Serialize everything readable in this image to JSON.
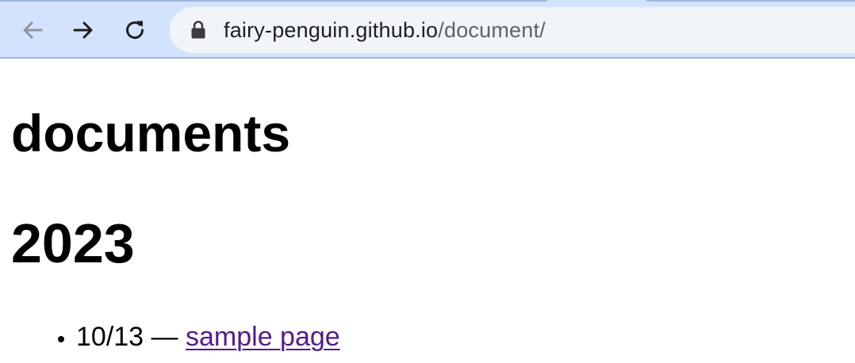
{
  "browser": {
    "url_host": "fairy-penguin.github.io",
    "url_path": "/document/"
  },
  "page": {
    "title": "documents",
    "sections": [
      {
        "year": "2023",
        "items": [
          {
            "date": "10/13",
            "separator": "—",
            "link_text": "sample page"
          }
        ]
      }
    ]
  },
  "colors": {
    "toolbar_bg": "#d3e3fd",
    "omnibox_bg": "#f1f4f9",
    "visited_link": "#551a8b"
  },
  "icons": [
    "back-arrow-icon",
    "forward-arrow-icon",
    "reload-icon",
    "lock-icon"
  ]
}
